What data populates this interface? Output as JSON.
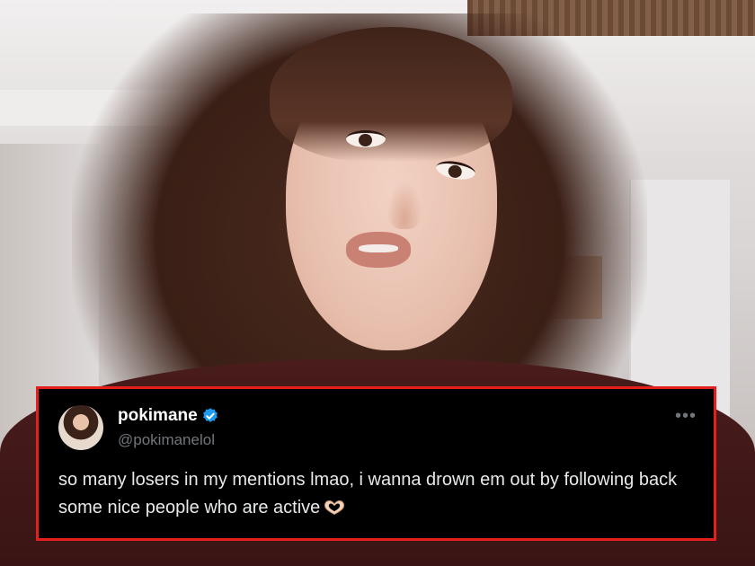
{
  "tweet": {
    "user_name": "pokimane",
    "handle": "@pokimanelol",
    "text": "so many losers in my mentions lmao, i wanna drown em out by following back some nice people who are active",
    "more_icon": "more-horizontal-icon",
    "verified_icon": "verified-badge-icon",
    "emoji_icon": "heart-hands-icon",
    "colors": {
      "card_background": "#000000",
      "highlight_border": "#e3201b",
      "verified": "#1d9bf0",
      "handle": "#71767b",
      "text": "#e7e9ea"
    }
  }
}
